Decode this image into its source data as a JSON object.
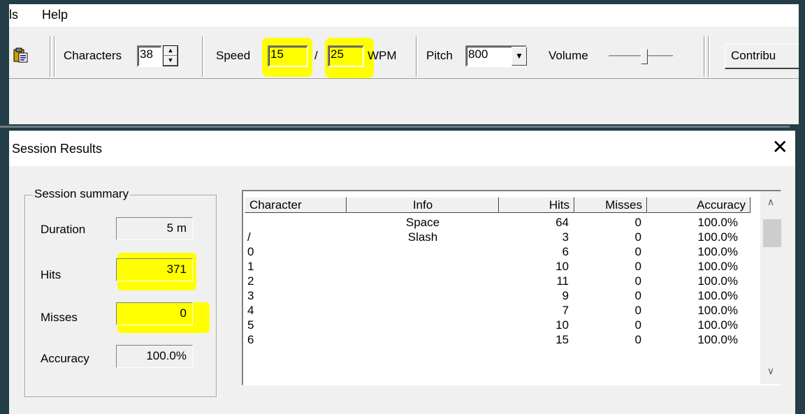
{
  "menubar": {
    "items": [
      "ls",
      "Help"
    ]
  },
  "toolbar": {
    "characters_label": "Characters",
    "characters_value": "38",
    "speed_label": "Speed",
    "speed_char_value": "15",
    "speed_separator": "/",
    "speed_effective_value": "25",
    "wpm_label": "WPM",
    "pitch_label": "Pitch",
    "pitch_value": "800",
    "volume_label": "Volume",
    "contribute_label": "Contribu",
    "highlight_color": "#ffff00"
  },
  "dialog": {
    "title": "Session Results",
    "close_glyph": "✕",
    "summary": {
      "legend": "Session summary",
      "duration_label": "Duration",
      "duration_value": "5 m",
      "hits_label": "Hits",
      "hits_value": "371",
      "misses_label": "Misses",
      "misses_value": "0",
      "accuracy_label": "Accuracy",
      "accuracy_value": "100.0%"
    },
    "table": {
      "columns": [
        "Character",
        "Info",
        "Hits",
        "Misses",
        "Accuracy"
      ],
      "rows": [
        {
          "character": "",
          "info": "Space",
          "hits": "64",
          "misses": "0",
          "accuracy": "100.0%"
        },
        {
          "character": "/",
          "info": "Slash",
          "hits": "3",
          "misses": "0",
          "accuracy": "100.0%"
        },
        {
          "character": "0",
          "info": "",
          "hits": "6",
          "misses": "0",
          "accuracy": "100.0%"
        },
        {
          "character": "1",
          "info": "",
          "hits": "10",
          "misses": "0",
          "accuracy": "100.0%"
        },
        {
          "character": "2",
          "info": "",
          "hits": "11",
          "misses": "0",
          "accuracy": "100.0%"
        },
        {
          "character": "3",
          "info": "",
          "hits": "9",
          "misses": "0",
          "accuracy": "100.0%"
        },
        {
          "character": "4",
          "info": "",
          "hits": "7",
          "misses": "0",
          "accuracy": "100.0%"
        },
        {
          "character": "5",
          "info": "",
          "hits": "10",
          "misses": "0",
          "accuracy": "100.0%"
        },
        {
          "character": "6",
          "info": "",
          "hits": "15",
          "misses": "0",
          "accuracy": "100.0%"
        }
      ]
    },
    "scroll_up_glyph": "∧",
    "scroll_down_glyph": "∨"
  }
}
